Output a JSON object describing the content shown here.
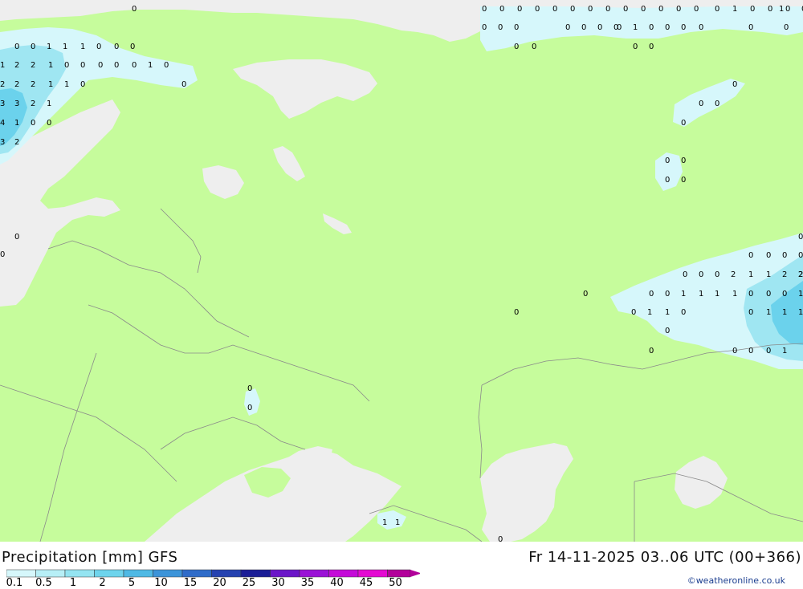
{
  "title_left": "Precipitation [mm] GFS",
  "title_right": "Fr 14-11-2025 03..06 UTC (00+366)",
  "credit": "©weatheronline.co.uk",
  "colors": {
    "land": "#c6fc9c",
    "sea": "#eeeeee",
    "border": "#8a8a8a",
    "precip_light": "#d6f7fb",
    "precip_mid": "#9fe6f2",
    "precip_heavy": "#6bd2ec"
  },
  "legend": {
    "ticks": [
      "0.1",
      "0.5",
      "1",
      "2",
      "5",
      "10",
      "15",
      "20",
      "25",
      "30",
      "35",
      "40",
      "45",
      "50"
    ],
    "colors": [
      "#d6f7fb",
      "#b7eff6",
      "#94e4f1",
      "#6ed4ec",
      "#4fb9e4",
      "#3c94d9",
      "#2f6cc9",
      "#2542b0",
      "#1a1d96",
      "#6b16c8",
      "#9a12d6",
      "#c40bd8",
      "#e40ad2",
      "#b2009a"
    ]
  },
  "precip_values": [
    "0",
    "0",
    "0",
    "0",
    "0",
    "0",
    "0",
    "0",
    "0",
    "0",
    "0",
    "0",
    "0",
    "0",
    "1",
    "0",
    "0",
    "0",
    "0",
    "0",
    "1",
    "0",
    "0",
    "0",
    "0",
    "0",
    "0",
    "0",
    "0",
    "1",
    "0",
    "0",
    "0",
    "0",
    "0",
    "0",
    "0",
    "0",
    "0",
    "0",
    "0",
    "0",
    "0",
    "0",
    "0",
    "1",
    "1",
    "1",
    "0",
    "0",
    "0",
    "1",
    "2",
    "2",
    "1",
    "0",
    "0",
    "0",
    "0",
    "0",
    "1",
    "0",
    "2",
    "2",
    "2",
    "1",
    "1",
    "0",
    "0",
    "3",
    "3",
    "2",
    "1",
    "4",
    "1",
    "0",
    "0",
    "3",
    "2",
    "0",
    "0",
    "0",
    "0",
    "0",
    "0",
    "0",
    "0",
    "0",
    "0",
    "0",
    "1",
    "1",
    "2",
    "2",
    "2",
    "0",
    "0",
    "0",
    "2",
    "0",
    "0",
    "0",
    "1",
    "1",
    "1",
    "1",
    "0",
    "0",
    "0",
    "1",
    "0",
    "0",
    "1",
    "1",
    "0",
    "0",
    "1",
    "1",
    "1",
    "0",
    "0",
    "0",
    "0",
    "0",
    "1",
    "0",
    "0",
    "1",
    "1",
    "0",
    "0"
  ]
}
